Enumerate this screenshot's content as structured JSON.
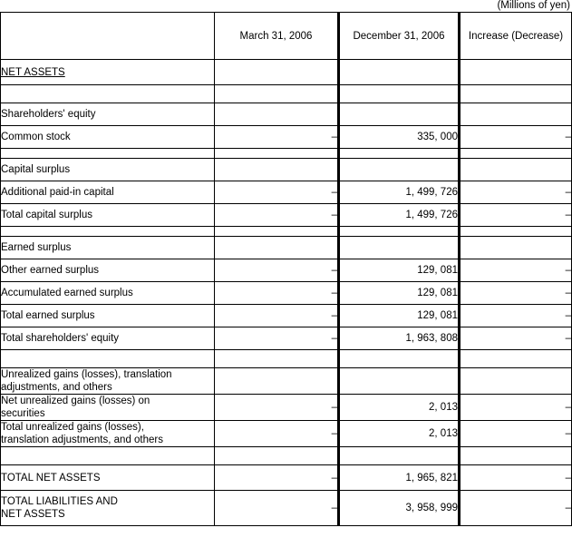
{
  "document": {
    "unit_note": "(Millions of yen)",
    "type": "balance-sheet-net-assets"
  },
  "table": {
    "columns": [
      {
        "key": "label",
        "header": ""
      },
      {
        "key": "mar2006",
        "header": "March 31, 2006"
      },
      {
        "key": "dec2006",
        "header": "December 31, 2006"
      },
      {
        "key": "change",
        "header": "Increase (Decrease)"
      }
    ],
    "section_title": "NET ASSETS",
    "rows": [
      {
        "label": "Shareholders' equity",
        "indent": 0,
        "mar2006": "",
        "dec2006": "",
        "change": ""
      },
      {
        "label": "Common stock",
        "indent": 1,
        "mar2006": "–",
        "dec2006": "335, 000",
        "change": "–"
      },
      {
        "label": "Capital surplus",
        "indent": 1,
        "mar2006": "",
        "dec2006": "",
        "change": ""
      },
      {
        "label": "Additional paid-in capital",
        "indent": 2,
        "mar2006": "–",
        "dec2006": "1, 499, 726",
        "change": "–"
      },
      {
        "label": "Total capital surplus",
        "indent": 2,
        "mar2006": "–",
        "dec2006": "1, 499, 726",
        "change": "–"
      },
      {
        "label": "Earned surplus",
        "indent": 1,
        "mar2006": "",
        "dec2006": "",
        "change": ""
      },
      {
        "label": "Other earned surplus",
        "indent": 2,
        "mar2006": "–",
        "dec2006": "129, 081",
        "change": "–"
      },
      {
        "label": "Accumulated earned surplus",
        "indent": 3,
        "mar2006": "–",
        "dec2006": "129, 081",
        "change": "–"
      },
      {
        "label": "Total earned surplus",
        "indent": 2,
        "mar2006": "–",
        "dec2006": "129, 081",
        "change": "–"
      },
      {
        "label": "Total shareholders' equity",
        "indent": 1,
        "mar2006": "–",
        "dec2006": "1, 963, 808",
        "change": "–"
      },
      {
        "label": "Unrealized gains (losses), translation adjustments, and others",
        "indent": 0,
        "mar2006": "",
        "dec2006": "",
        "change": ""
      },
      {
        "label": "Net unrealized gains (losses) on securities",
        "indent": 1,
        "mar2006": "–",
        "dec2006": "2, 013",
        "change": "–"
      },
      {
        "label": "Total unrealized gains (losses), translation adjustments, and others",
        "indent": 1,
        "mar2006": "–",
        "dec2006": "2, 013",
        "change": "–"
      }
    ],
    "total_rows": [
      {
        "label": "TOTAL NET ASSETS",
        "mar2006": "–",
        "dec2006": "1, 965, 821",
        "change": "–"
      },
      {
        "label": "TOTAL LIABILITIES AND NET ASSETS",
        "mar2006": "–",
        "dec2006": "3, 958, 999",
        "change": "–"
      }
    ]
  },
  "cells": {
    "hdr_label": "",
    "hdr_mar": "March 31, 2006",
    "hdr_dec": "December 31, 2006",
    "hdr_chg": "Increase (Decrease)",
    "net_assets": "NET ASSETS",
    "r0_label": "Shareholders' equity",
    "r1_label": "Common stock",
    "r1_mar": "–",
    "r1_dec": "335, 000",
    "r1_chg": "–",
    "r2_label": "Capital surplus",
    "r3_label": "Additional paid-in capital",
    "r3_mar": "–",
    "r3_dec": "1, 499, 726",
    "r3_chg": "–",
    "r4_label": "Total capital surplus",
    "r4_mar": "–",
    "r4_dec": "1, 499, 726",
    "r4_chg": "–",
    "r5_label": "Earned surplus",
    "r6_label": "Other earned surplus",
    "r6_mar": "–",
    "r6_dec": "129, 081",
    "r6_chg": "–",
    "r7_label": "Accumulated earned surplus",
    "r7_mar": "–",
    "r7_dec": "129, 081",
    "r7_chg": "–",
    "r8_label": "Total earned surplus",
    "r8_mar": "–",
    "r8_dec": "129, 081",
    "r8_chg": "–",
    "r9_label": "Total shareholders' equity",
    "r9_mar": "–",
    "r9_dec": "1, 963, 808",
    "r9_chg": "–",
    "r10_label_line1": "Unrealized gains (losses), translation",
    "r10_label_line2": "adjustments, and others",
    "r11_label_line1": "Net unrealized gains (losses) on",
    "r11_label_line2": "securities",
    "r11_mar": "–",
    "r11_dec": "2, 013",
    "r11_chg": "–",
    "r12_label_line1": "Total unrealized gains (losses),",
    "r12_label_line2": "translation adjustments, and others",
    "r12_mar": "–",
    "r12_dec": "2, 013",
    "r12_chg": "–",
    "t0_label": "TOTAL NET ASSETS",
    "t0_mar": "–",
    "t0_dec": "1, 965, 821",
    "t0_chg": "–",
    "t1_label_line1": "TOTAL LIABILITIES AND",
    "t1_label_line2": "NET ASSETS",
    "t1_mar": "–",
    "t1_dec": "3, 958, 999",
    "t1_chg": "–"
  }
}
